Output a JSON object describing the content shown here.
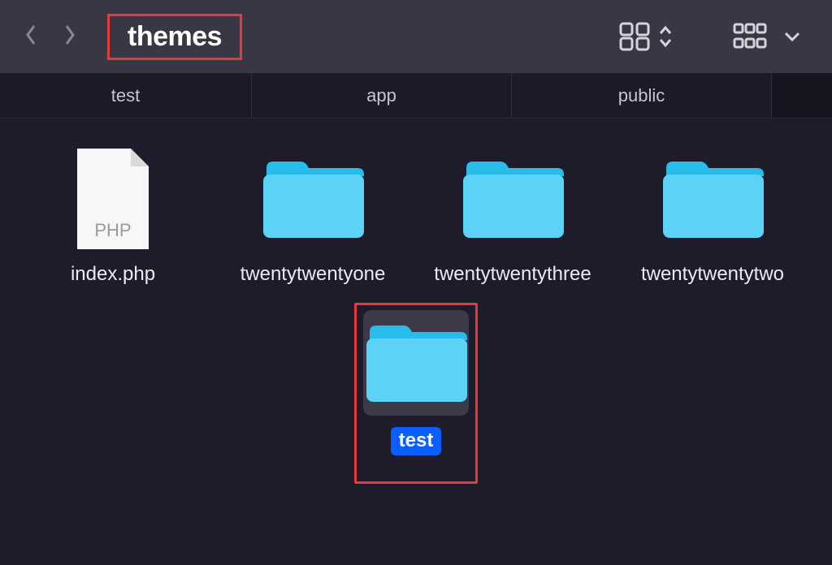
{
  "toolbar": {
    "title": "themes"
  },
  "tabs": [
    {
      "label": "test"
    },
    {
      "label": "app"
    },
    {
      "label": "public"
    }
  ],
  "items": [
    {
      "name": "index.php",
      "type": "file",
      "filetype": "PHP"
    },
    {
      "name": "twentytwentyone",
      "type": "folder"
    },
    {
      "name": "twentytwentythree",
      "type": "folder"
    },
    {
      "name": "twentytwentytwo",
      "type": "folder"
    },
    {
      "name": "test",
      "type": "folder",
      "selected": true,
      "highlighted": true
    }
  ],
  "colors": {
    "folder_light": "#5bd2f6",
    "folder_dark": "#28bcec",
    "highlight": "#e63a3a",
    "select_label": "#0b5fff"
  }
}
